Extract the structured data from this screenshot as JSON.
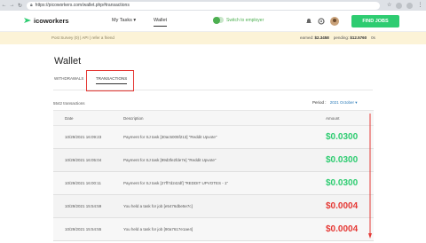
{
  "browser": {
    "url": "https://picoworkers.com/wallet.php#transactions"
  },
  "header": {
    "logo_text": "icoworkers",
    "my_tasks": "My Tasks ▾",
    "wallet": "Wallet",
    "switch_label": "Switch to employer",
    "find_jobs": "FIND JOBS"
  },
  "info_bar": {
    "left_text": "Post Survey (0) | API | refer a friend",
    "earned_label": "earned:",
    "earned_value": "$2.3458",
    "pending_label": "pending:",
    "pending_value": "$12.5760",
    "tail": "0s"
  },
  "page": {
    "title": "Wallet",
    "tabs": [
      "WITHDRAWALS",
      "TRANSACTIONS"
    ],
    "count_text": "5542 transactions",
    "period_label": "Period :",
    "period_value": "2021 October ▾"
  },
  "table": {
    "headers": [
      "Date",
      "Description",
      "Amount"
    ],
    "rows": [
      {
        "date": "10/29/2021 16:09:23",
        "desc": "Payment for SJ task [30ac5005f213] \"Reddit Upvote\"",
        "amount": "$0.0300",
        "type": "pos"
      },
      {
        "date": "10/29/2021 16:05:04",
        "desc": "Payment for SJ task [99d3fe2fde7e] \"Reddit Upvote\"",
        "amount": "$0.0300",
        "type": "pos"
      },
      {
        "date": "10/29/2021 16:00:11",
        "desc": "Payment for SJ task [27ff7d242df] \"REDDIT UPVOTES - 1\"",
        "amount": "$0.0300",
        "type": "pos"
      },
      {
        "date": "10/29/2021 15:54:59",
        "desc": "You held a task for job [e5476dbe5e7c]",
        "amount": "$0.0004",
        "type": "neg"
      },
      {
        "date": "10/29/2021 15:54:55",
        "desc": "You held a task for job [90a7617e1ae4]",
        "amount": "$0.0004",
        "type": "neg"
      }
    ]
  },
  "colors": {
    "accent_green": "#2ecc71",
    "negative_red": "#e53935",
    "highlight": "#e53935"
  }
}
